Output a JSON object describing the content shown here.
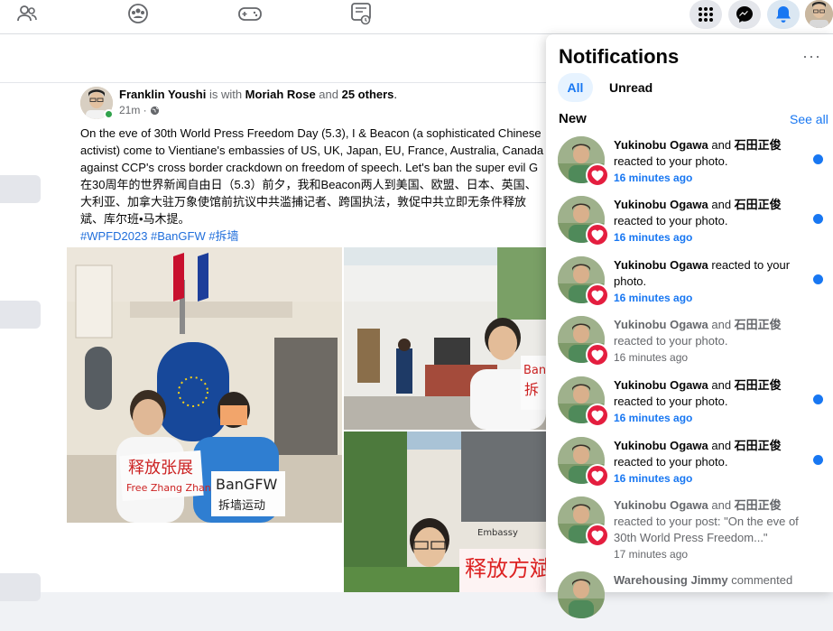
{
  "topbar": {
    "icons": [
      "friends-icon",
      "groups-icon",
      "gaming-icon",
      "feeds-icon"
    ],
    "right_buttons": [
      "menu-grid-icon",
      "messenger-icon",
      "notifications-bell-icon"
    ],
    "accent": "#1877f2"
  },
  "post": {
    "author": "Franklin Youshi",
    "with_text": " is with ",
    "tagged": "Moriah Rose",
    "and_text": " and ",
    "others": "25 others",
    "period": ".",
    "time": "21m ·",
    "privacy_icon": "globe-icon",
    "lines": [
      "On the eve of 30th World Press Freedom Day (5.3), I & Beacon (a sophisticated Chinese",
      "activist) come to Vientiane's embassies of US, UK, Japan, EU, France, Australia, Canada t",
      "against  CCP's cross border crackdown on freedom of speech. Let's ban the super evil G",
      "在30周年的世界新闻自由日（5.3）前夕，我和Beacon两人到美国、欧盟、日本、英国、",
      "大利亚、加拿大驻万象使馆前抗议中共滥捕记者、跨国执法，敦促中共立即无条件释放",
      "斌、库尔班•马木提。"
    ],
    "hashtags": "#WPFD2023 #BanGFW #拆墙",
    "photo1": {
      "sign_left": "释放张展",
      "sign_left_sub": "Free Zhang Zhan",
      "sign_right": "BanGFW",
      "sign_right_sub": "拆墙运动"
    },
    "photo2": {
      "sign": "Ban",
      "sign_sub": "拆"
    },
    "photo3": {
      "sign": "释放方斌",
      "embassy_label": "Embassy"
    }
  },
  "notifications": {
    "title": "Notifications",
    "more": "···",
    "tab_all": "All",
    "tab_unread": "Unread",
    "section": "New",
    "see_all": "See all",
    "items": [
      {
        "name1": "Yukinobu Ogawa",
        "joiner": " and ",
        "name2": "石田正俊",
        "action": "reacted to your photo.",
        "time": "16 minutes ago",
        "unread": true
      },
      {
        "name1": "Yukinobu Ogawa",
        "joiner": " and ",
        "name2": "石田正俊",
        "action": "reacted to your photo.",
        "time": "16 minutes ago",
        "unread": true
      },
      {
        "name1": "Yukinobu Ogawa",
        "joiner": "",
        "name2": "",
        "action": " reacted to your photo.",
        "time": "16 minutes ago",
        "unread": true
      },
      {
        "name1": "Yukinobu Ogawa",
        "joiner": " and ",
        "name2": "石田正俊",
        "action": "reacted to your photo.",
        "time": "16 minutes ago",
        "unread": false
      },
      {
        "name1": "Yukinobu Ogawa",
        "joiner": " and ",
        "name2": "石田正俊",
        "action": "reacted to your photo.",
        "time": "16 minutes ago",
        "unread": true
      },
      {
        "name1": "Yukinobu Ogawa",
        "joiner": " and ",
        "name2": "石田正俊",
        "action": "reacted to your photo.",
        "time": "16 minutes ago",
        "unread": true
      },
      {
        "name1": "Yukinobu Ogawa",
        "joiner": " and ",
        "name2": "石田正俊",
        "action": "reacted to your post: \"On the eve of 30th World Press Freedom...\"",
        "time": "17 minutes ago",
        "unread": false
      },
      {
        "name1": "Warehousing Jimmy",
        "joiner": "",
        "name2": "",
        "action": " commented",
        "time": "",
        "unread": false
      }
    ]
  }
}
